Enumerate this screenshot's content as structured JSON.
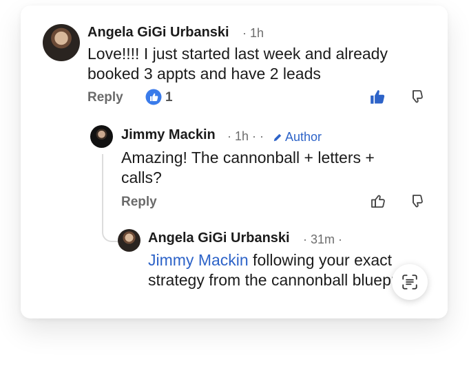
{
  "comments": [
    {
      "author": "Angela GiGi Urbanski",
      "time": "· 1h",
      "text": "Love!!!! I just started last week and already booked 3 appts and have 2 leads",
      "reply_label": "Reply",
      "reaction_count": "1"
    },
    {
      "author": "Jimmy Mackin",
      "time": "· 1h · ·",
      "author_badge": "Author",
      "text": "Amazing! The cannonball + letters + calls?",
      "reply_label": "Reply"
    },
    {
      "author": "Angela GiGi Urbanski",
      "time": "· 31m ·",
      "mention": "Jimmy Mackin",
      "text": " following your exact strategy from the cannonball blueprint"
    }
  ],
  "colors": {
    "accent": "#2d63c8",
    "like_active": "#2d63c8"
  },
  "icons": [
    "thumbs-up-icon",
    "thumbs-down-icon",
    "pencil-icon",
    "scan-text-icon"
  ]
}
